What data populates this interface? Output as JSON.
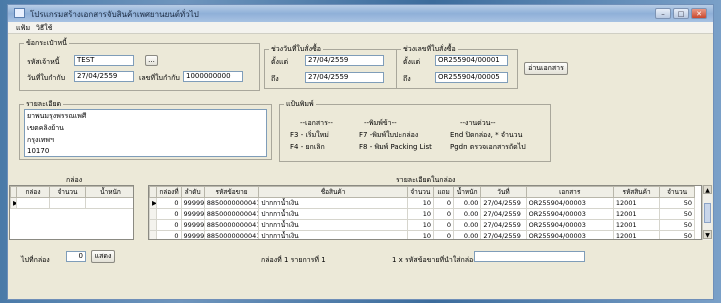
{
  "window": {
    "title": "โปรแกรมสร้างเอกสารจับสินค้าเพศยานยนต์ทั่วไป"
  },
  "menu": [
    "แฟ้ม",
    "วิธีใช้"
  ],
  "customer_group": {
    "legend": "ข้อกระเป๋าหนี้",
    "code_label": "รหัสเจ้าหนี้",
    "code_value": "TEST",
    "date_label": "วันที่ใบกำกับ",
    "date_value": "27/04/2559",
    "doc_label": "เลขที่ใบกำกับ",
    "doc_value": "1000000000",
    "browse_label": "..."
  },
  "date_range": {
    "legend": "ช่วงวันที่ใบสั่งซื้อ",
    "from_label": "ตั้งแต่",
    "from_value": "27/04/2559",
    "to_label": "ถึง",
    "to_value": "27/04/2559"
  },
  "po_range": {
    "legend": "ช่วงเลขที่ใบสั่งซื้อ",
    "from_label": "ตั้งแต่",
    "from_value": "OR255904/00001",
    "to_label": "ถึง",
    "to_value": "OR255904/00005"
  },
  "read_button": "อ่านเอกสาร",
  "details": {
    "legend": "รายละเอียด",
    "lines": [
      "ยาพนมรุงพรรณเพศี",
      "เขตคลิงย้าน",
      "กรุงเทพฯ",
      "10170"
    ]
  },
  "print_group": {
    "legend": "แป้นพิมพ์",
    "col1_header": "--เอกสาร--",
    "col1": [
      "F3 - เริ่มใหม่",
      "F4 - ยกเลิก"
    ],
    "col2_header": "--พิมพ์ข้า--",
    "col2": [
      "F7 -พิมพ์ใบปะกล่อง",
      "F8 - พิมพ์ Packing List"
    ],
    "col3_header": "--งานด่วน--",
    "col3": [
      "End ปิดกล่อง, * จำนวน",
      "Pgdn ตรวจเอกสารถัดไป"
    ]
  },
  "box_panel": {
    "title": "กล่อง",
    "columns": [
      "กล่อง",
      "จำนวน",
      "น้ำหนัก"
    ]
  },
  "detail_panel": {
    "title": "รายละเอียดในกล่อง",
    "columns": [
      "กล่องที่",
      "ลำดับ",
      "รหัสข้อขาย",
      "ชื่อสินค้า",
      "จำนวน",
      "แถม",
      "น้ำหนัก",
      "วันที่",
      "เอกสาร",
      "รหัสสินค้า",
      "จำนวน"
    ],
    "rows": [
      [
        "0",
        "99999",
        "8850000000041",
        "ปากกาน้ำเงิน",
        "10",
        "0",
        "0.00",
        "27/04/2559",
        "OR255904/00003",
        "12001",
        "50"
      ],
      [
        "0",
        "99999",
        "8850000000041",
        "ปากกาน้ำเงิน",
        "10",
        "0",
        "0.00",
        "27/04/2559",
        "OR255904/00003",
        "12001",
        "50"
      ],
      [
        "0",
        "99999",
        "8850000000041",
        "ปากกาน้ำเงิน",
        "10",
        "0",
        "0.00",
        "27/04/2559",
        "OR255904/00003",
        "12001",
        "50"
      ],
      [
        "0",
        "99999",
        "8850000000041",
        "ปากกาน้ำเงิน",
        "10",
        "0",
        "0.00",
        "27/04/2559",
        "OR255904/00003",
        "12001",
        "50"
      ],
      [
        "0",
        "99999",
        "8850000000041",
        "ปากกาน้ำเงิน",
        "10",
        "0",
        "0.00",
        "27/04/2559",
        "OR255904/00003",
        "12001",
        "50"
      ],
      [
        "0",
        "99999",
        "8850000000041",
        "ปากกาน้ำเงิน",
        "10",
        "0",
        "0.00",
        "27/04/2559",
        "OR255904/00003",
        "12001",
        "50"
      ],
      [
        "0",
        "99999",
        "8850000000041",
        "ปากกาน้ำเงิน",
        "10",
        "0",
        "0.00",
        "27/04/2559",
        "OR255904/00003",
        "12001",
        "50"
      ]
    ]
  },
  "footer": {
    "box_label": "ไปที่กล่อง",
    "box_value": "0",
    "show_button": "แสดง",
    "status": "กล่องที่ 1 รายการที่ 1",
    "scan_label": "1 x รหัสข้อขายที่นำใส่กล่อง",
    "scan_value": ""
  }
}
